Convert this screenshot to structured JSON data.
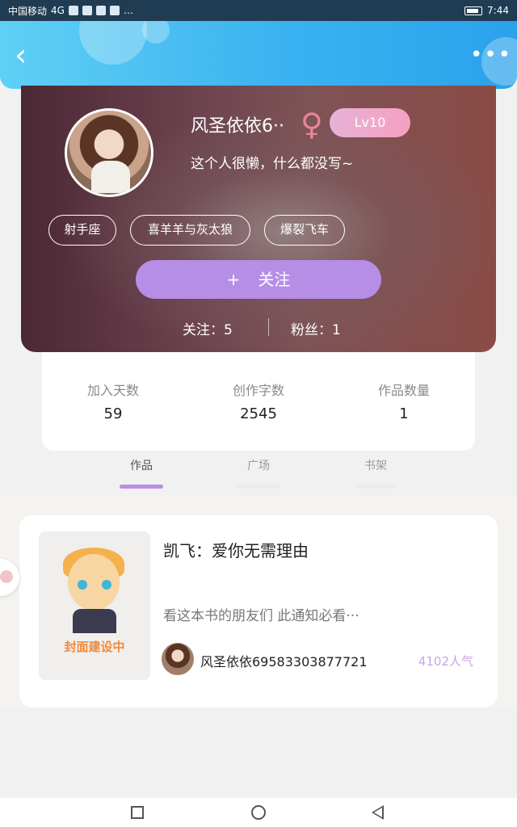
{
  "status_bar": {
    "carrier": "中国移动",
    "network": "4G",
    "extra_icons": "…",
    "time": "7:44"
  },
  "header": {
    "back_icon": "chevron-left-icon",
    "more_icon": "more-dots-icon",
    "more_label": "•••"
  },
  "profile": {
    "nickname": "风圣依依6··",
    "gender_symbol": "♀",
    "gender_color": "#e8849b",
    "level": "Lv10",
    "bio": "这个人很懒，什么都没写~",
    "tags": [
      "射手座",
      "喜羊羊与灰太狼",
      "爆裂飞车"
    ],
    "follow_plus": "+",
    "follow_label": "关注",
    "following_text": "关注：5",
    "fans_text": "粉丝：1"
  },
  "counts": [
    {
      "label": "加入天数",
      "value": "59"
    },
    {
      "label": "创作字数",
      "value": "2545"
    },
    {
      "label": "作品数量",
      "value": "1"
    }
  ],
  "tabs": [
    {
      "label": "作品",
      "active": true
    },
    {
      "label": "广场",
      "active": false
    },
    {
      "label": "书架",
      "active": false
    }
  ],
  "work": {
    "cover_text": "封面建设中",
    "title": "凯飞：爱你无需理由",
    "description": "看这本书的朋友们      此通知必看···",
    "author": "风圣依依69583303877721",
    "popularity": "4102人气"
  },
  "colors": {
    "header_start": "#5fd0f5",
    "header_end": "#2aa2ec",
    "accent_purple": "#b68ee6",
    "level_pink": "#f6a0c0",
    "popularity_purple": "#c5a6e6"
  },
  "navbar": {
    "icons": [
      "recent-apps-icon",
      "home-icon",
      "back-triangle-icon"
    ]
  }
}
